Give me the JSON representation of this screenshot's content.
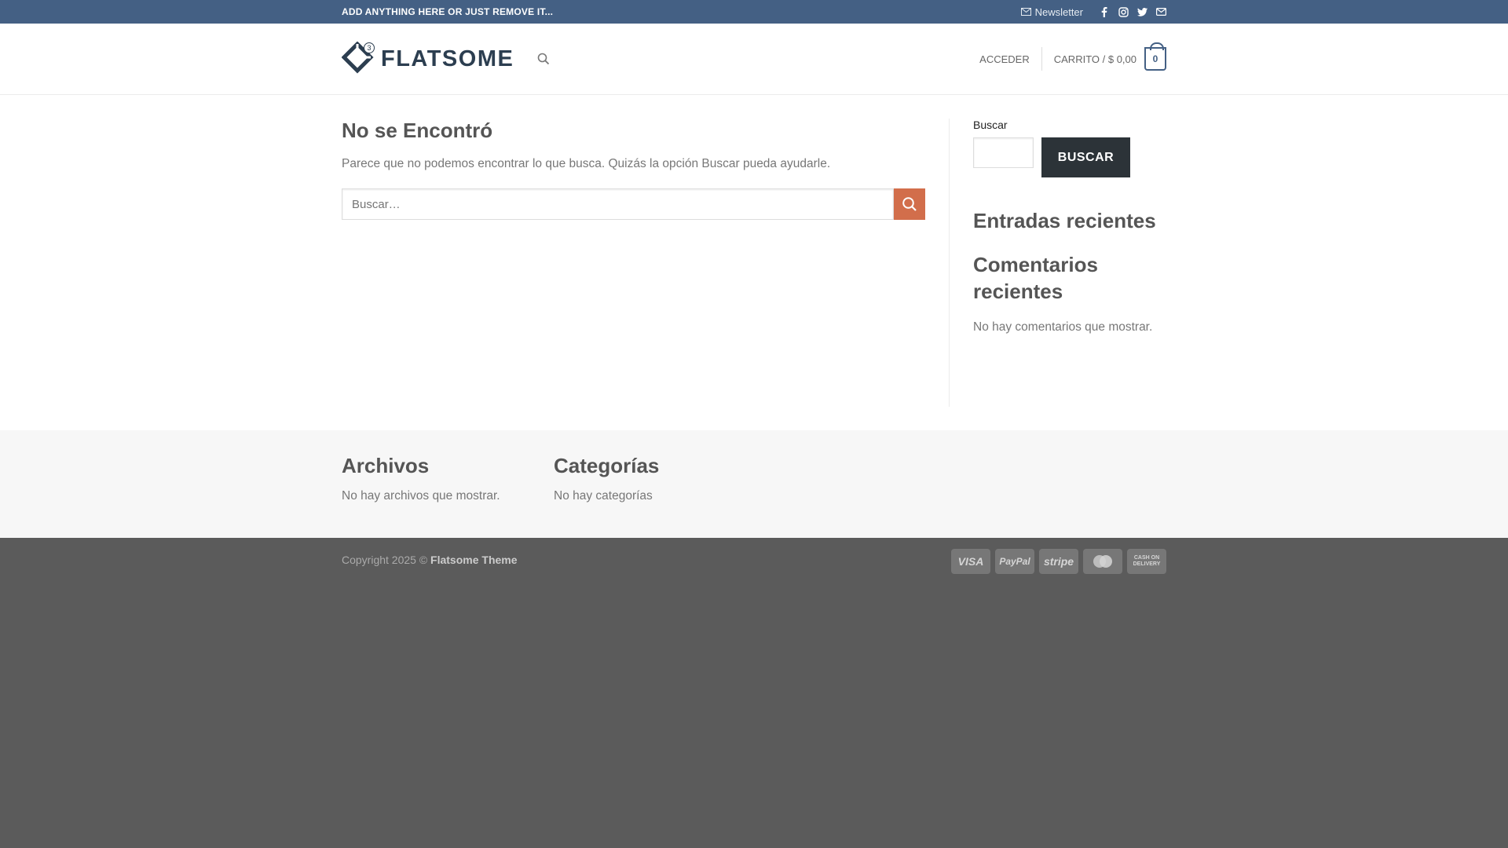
{
  "topbar": {
    "message": "ADD ANYTHING HERE OR JUST REMOVE IT...",
    "newsletter": "Newsletter",
    "icons": [
      "facebook-icon",
      "instagram-icon",
      "twitter-icon",
      "email-icon"
    ]
  },
  "header": {
    "logo_text": "FLATSOME",
    "logo_badge": "3",
    "login": "ACCEDER",
    "cart": "CARRITO / $ 0,00",
    "cart_count": "0"
  },
  "main": {
    "title": "No se Encontró",
    "message": "Parece que no podemos encontrar lo que busca. Quizás la opción Buscar pueda ayudarle.",
    "search_placeholder": "Buscar…"
  },
  "sidebar": {
    "search_label": "Buscar",
    "search_button": "BUSCAR",
    "recent_posts": "Entradas recientes",
    "recent_comments": "Comentarios recientes",
    "no_comments": "No hay comentarios que mostrar."
  },
  "footer_widgets": {
    "archives_title": "Archivos",
    "archives_empty": "No hay archivos que mostrar.",
    "categories_title": "Categorías",
    "categories_empty": "No hay categorías"
  },
  "footer": {
    "copyright": "Copyright 2025 ©",
    "theme": "Flatsome Theme",
    "payments": [
      "VISA",
      "PayPal",
      "stripe",
      "CASH ON DELIVERY"
    ]
  },
  "colors": {
    "primary": "#446084",
    "accent": "#d26e4b",
    "footer": "#5b5b5b"
  }
}
